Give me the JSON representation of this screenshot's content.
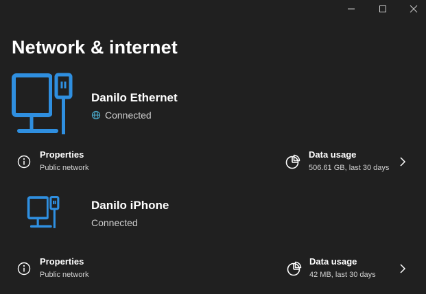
{
  "window": {
    "controls": {
      "minimize": "minimize-icon",
      "maximize": "maximize-icon",
      "close": "close-icon"
    }
  },
  "page": {
    "title": "Network & internet"
  },
  "connections": [
    {
      "name": "Danilo Ethernet",
      "status": "Connected",
      "status_icon": "globe-icon",
      "device_icon": "ethernet-pc-icon",
      "properties": {
        "title": "Properties",
        "subtitle": "Public network",
        "icon": "info-icon"
      },
      "data_usage": {
        "title": "Data usage",
        "subtitle": "506.61 GB, last 30 days",
        "icon": "pie-chart-icon"
      }
    },
    {
      "name": "Danilo iPhone",
      "status": "Connected",
      "device_icon": "ethernet-pc-icon",
      "properties": {
        "title": "Properties",
        "subtitle": "Public network",
        "icon": "info-icon"
      },
      "data_usage": {
        "title": "Data usage",
        "subtitle": "42 MB, last 30 days",
        "icon": "pie-chart-icon"
      }
    }
  ],
  "colors": {
    "background": "#202020",
    "accent": "#2f8fe0",
    "globe": "#4aa8c8",
    "text": "#ffffff",
    "subtext": "#cfcfcf"
  }
}
